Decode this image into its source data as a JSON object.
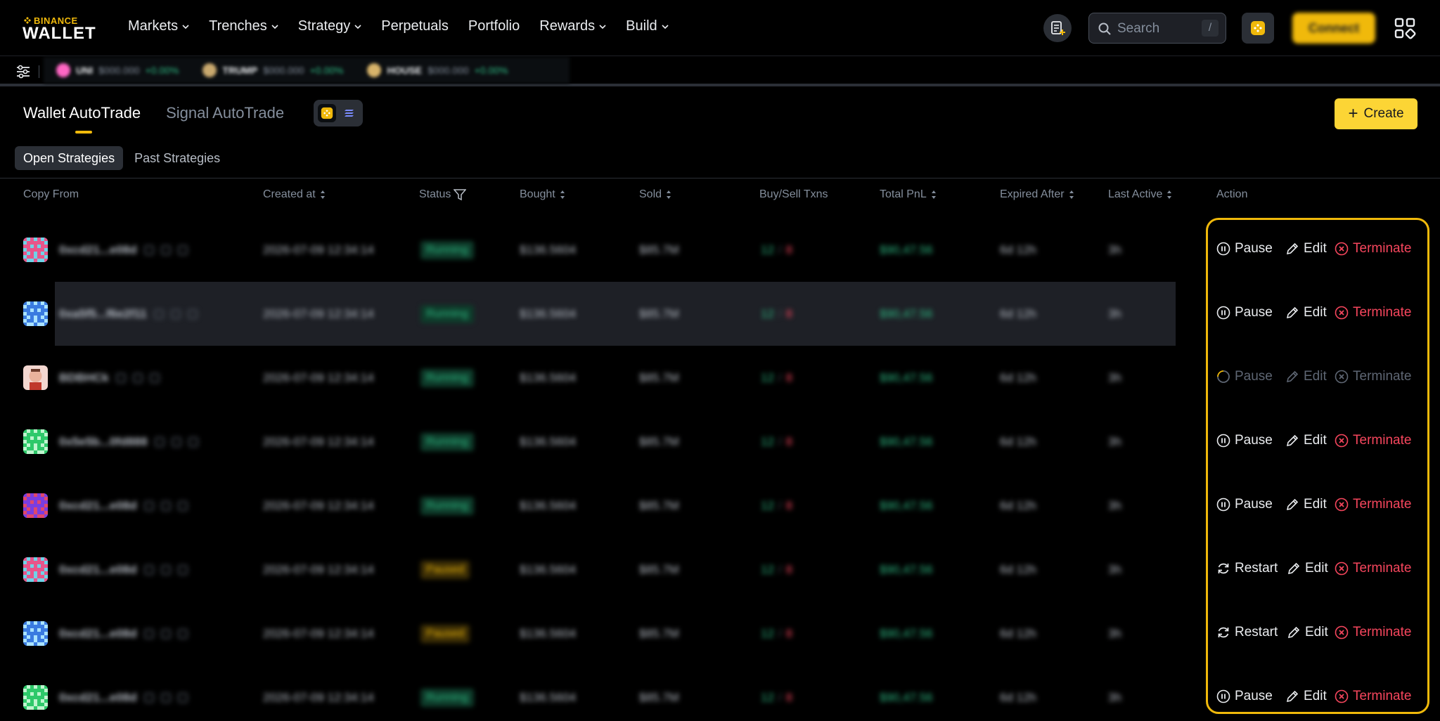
{
  "brand": {
    "top": "BINANCE",
    "bottom": "WALLET"
  },
  "nav": [
    {
      "label": "Markets",
      "dropdown": true
    },
    {
      "label": "Trenches",
      "dropdown": true
    },
    {
      "label": "Strategy",
      "dropdown": true
    },
    {
      "label": "Perpetuals",
      "dropdown": false
    },
    {
      "label": "Portfolio",
      "dropdown": false
    },
    {
      "label": "Rewards",
      "dropdown": true
    },
    {
      "label": "Build",
      "dropdown": true
    }
  ],
  "search": {
    "placeholder": "Search",
    "shortcut": "/"
  },
  "connect_label": "Connect",
  "ticker": [
    {
      "symbol": "UNI",
      "price": "$000.000",
      "change": "+0.00%"
    },
    {
      "symbol": "TRUMP",
      "price": "$000.000",
      "change": "+0.00%"
    },
    {
      "symbol": "HOUSE",
      "price": "$000.000",
      "change": "+0.00%"
    }
  ],
  "tabs": {
    "wallet": "Wallet AutoTrade",
    "signal": "Signal AutoTrade"
  },
  "create_label": "Create",
  "subtabs": {
    "open": "Open Strategies",
    "past": "Past Strategies"
  },
  "columns": {
    "copy_from": "Copy From",
    "created_at": "Created at",
    "status": "Status",
    "bought": "Bought",
    "sold": "Sold",
    "txns": "Buy/Sell Txns",
    "pnl": "Total PnL",
    "expired": "Expired After",
    "last_active": "Last Active",
    "action": "Action"
  },
  "rows": [
    {
      "addr": "0xcd21...e08d",
      "created": "2026-07-09 12:34:14",
      "status": "Running",
      "status_type": "run",
      "bought": "$136.5604",
      "sold": "$85.7M",
      "buys": "12",
      "sells": "8",
      "pnl": "$90,47.56",
      "expired": "6d 12h",
      "last": "3h",
      "primary": "Pause",
      "primary_icon": "pause",
      "disabled": false,
      "avatar": "a1"
    },
    {
      "addr": "0xa5f5...f6e2f11",
      "created": "2026-07-09 12:34:14",
      "status": "Running",
      "status_type": "run",
      "bought": "$136.5604",
      "sold": "$85.7M",
      "buys": "12",
      "sells": "8",
      "pnl": "$90,47.56",
      "expired": "6d 12h",
      "last": "3h",
      "primary": "Pause",
      "primary_icon": "pause",
      "disabled": false,
      "avatar": "a2"
    },
    {
      "addr": "BDBHCk",
      "created": "2026-07-09 12:34:14",
      "status": "Running",
      "status_type": "run",
      "bought": "$136.5604",
      "sold": "$85.7M",
      "buys": "12",
      "sells": "8",
      "pnl": "$90,47.56",
      "expired": "6d 12h",
      "last": "3h",
      "primary": "Pause",
      "primary_icon": "loading",
      "disabled": true,
      "avatar": "a3"
    },
    {
      "addr": "0x5e5b...0fd888",
      "created": "2026-07-09 12:34:14",
      "status": "Running",
      "status_type": "run",
      "bought": "$136.5604",
      "sold": "$85.7M",
      "buys": "12",
      "sells": "8",
      "pnl": "$90,47.56",
      "expired": "6d 12h",
      "last": "3h",
      "primary": "Pause",
      "primary_icon": "pause",
      "disabled": false,
      "avatar": "a4"
    },
    {
      "addr": "0xcd21...e08d",
      "created": "2026-07-09 12:34:14",
      "status": "Running",
      "status_type": "run",
      "bought": "$136.5604",
      "sold": "$85.7M",
      "buys": "12",
      "sells": "8",
      "pnl": "$90,47.56",
      "expired": "6d 12h",
      "last": "3h",
      "primary": "Pause",
      "primary_icon": "pause",
      "disabled": false,
      "avatar": "a5"
    },
    {
      "addr": "0xcd21...e08d",
      "created": "2026-07-09 12:34:14",
      "status": "Paused",
      "status_type": "pause",
      "bought": "$136.5604",
      "sold": "$85.7M",
      "buys": "12",
      "sells": "8",
      "pnl": "$90,47.56",
      "expired": "6d 12h",
      "last": "3h",
      "primary": "Restart",
      "primary_icon": "restart",
      "disabled": false,
      "avatar": "a1"
    },
    {
      "addr": "0xcd21...e08d",
      "created": "2026-07-09 12:34:14",
      "status": "Paused",
      "status_type": "pause",
      "bought": "$136.5604",
      "sold": "$85.7M",
      "buys": "12",
      "sells": "8",
      "pnl": "$90,47.56",
      "expired": "6d 12h",
      "last": "3h",
      "primary": "Restart",
      "primary_icon": "restart",
      "disabled": false,
      "avatar": "a2"
    },
    {
      "addr": "0xcd21...e08d",
      "created": "2026-07-09 12:34:14",
      "status": "Running",
      "status_type": "run",
      "bought": "$136.5604",
      "sold": "$85.7M",
      "buys": "12",
      "sells": "8",
      "pnl": "$90,47.56",
      "expired": "6d 12h",
      "last": "3h",
      "primary": "Pause",
      "primary_icon": "pause",
      "disabled": false,
      "avatar": "a4"
    }
  ],
  "actions": {
    "edit": "Edit",
    "terminate": "Terminate"
  },
  "colors": {
    "accent": "#f0b90b",
    "green": "#2ebd85",
    "red": "#f6465d",
    "bg": "#000000"
  }
}
